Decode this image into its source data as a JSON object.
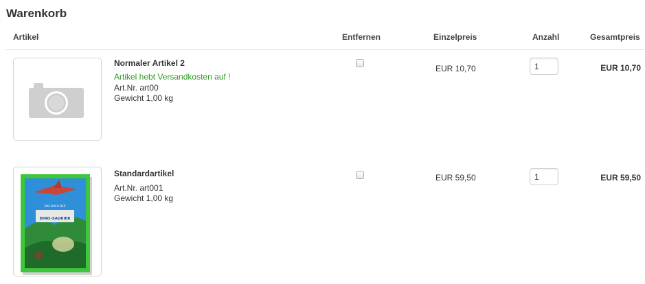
{
  "cart": {
    "title": "Warenkorb",
    "columns": {
      "article": "Artikel",
      "remove": "Entfernen",
      "unit_price": "Einzelpreis",
      "quantity": "Anzahl",
      "total_price": "Gesamtpreis"
    },
    "items": [
      {
        "name": "Normaler Artikel 2",
        "notice": "Artikel hebt Versandkosten auf !",
        "sku": "Art.Nr. art00",
        "weight": "Gewicht 1,00 kg",
        "remove_checked": false,
        "unit_price": "EUR 10,70",
        "quantity": "1",
        "total_price": "EUR 10,70",
        "image_icon": "camera-placeholder-icon"
      },
      {
        "name": "Standardartikel",
        "sku": "Art.Nr. art001",
        "weight": "Gewicht 1,00 kg",
        "remove_checked": false,
        "unit_price": "EUR 59,50",
        "quantity": "1",
        "total_price": "EUR 59,50",
        "image_cover_text": "DINO-SAURIER",
        "image_colors": {
          "frame": "#3fc63a",
          "sky": "#2f8fd8",
          "jungle": "#2f8a3a"
        }
      }
    ]
  }
}
